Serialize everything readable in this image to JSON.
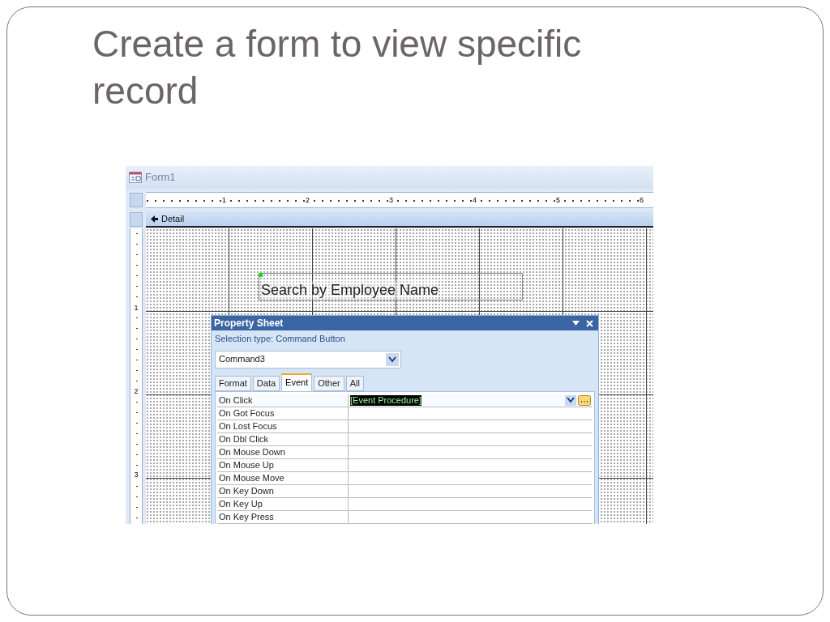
{
  "slide": {
    "title": "Create a form to view specific record"
  },
  "form": {
    "title": "Form1",
    "ruler_marks": [
      "1",
      "2",
      "3",
      "4",
      "5",
      "6"
    ],
    "vertical_ruler_marks": [
      "1",
      "2",
      "3"
    ],
    "section": "Detail",
    "label": "Search by Employee Name",
    "property_sheet": {
      "title": "Property Sheet",
      "selection_type": "Selection type:  Command Button",
      "object": "Command3",
      "tabs": [
        {
          "label": "Format",
          "selected": false
        },
        {
          "label": "Data",
          "selected": false
        },
        {
          "label": "Event",
          "selected": true
        },
        {
          "label": "Other",
          "selected": false
        },
        {
          "label": "All",
          "selected": false
        }
      ],
      "rows": [
        {
          "name": "On Click",
          "value": "[Event Procedure]",
          "selected": true
        },
        {
          "name": "On Got Focus",
          "selected": false
        },
        {
          "name": "On Lost Focus",
          "selected": false
        },
        {
          "name": "On Dbl Click",
          "selected": false
        },
        {
          "name": "On Mouse Down",
          "selected": false
        },
        {
          "name": "On Mouse Up",
          "selected": false
        },
        {
          "name": "On Mouse Move",
          "selected": false
        },
        {
          "name": "On Key Down",
          "selected": false
        },
        {
          "name": "On Key Up",
          "selected": false
        },
        {
          "name": "On Key Press",
          "selected": false
        }
      ]
    }
  }
}
